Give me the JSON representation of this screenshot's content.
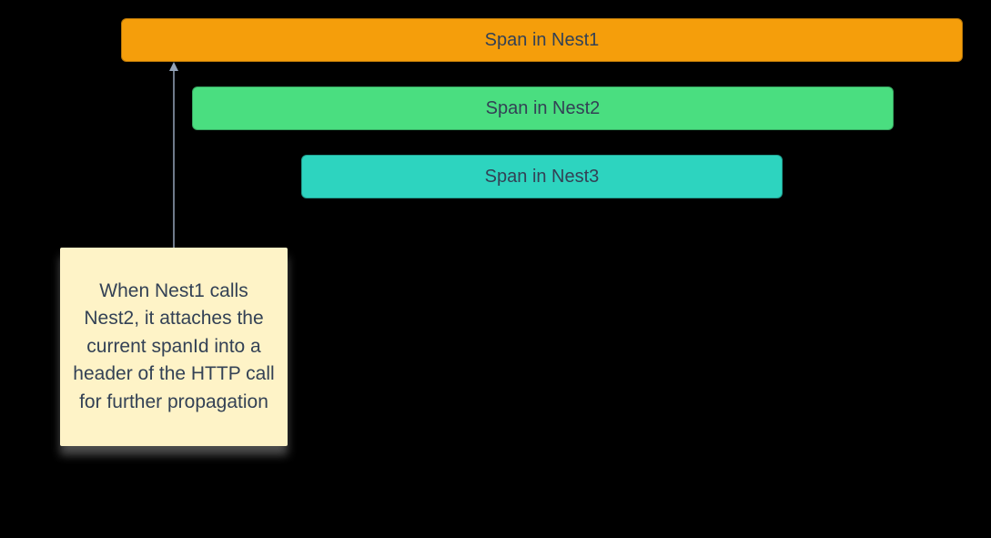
{
  "spans": {
    "nest1": {
      "label": "Span in Nest1",
      "color": "#f59e0b"
    },
    "nest2": {
      "label": "Span in Nest2",
      "color": "#4ade80"
    },
    "nest3": {
      "label": "Span in Nest3",
      "color": "#2dd4bf"
    }
  },
  "note": {
    "text": "When Nest1 calls Nest2, it attaches the current spanId into a header of the HTTP call for further propagation",
    "background": "#fef3c7"
  }
}
